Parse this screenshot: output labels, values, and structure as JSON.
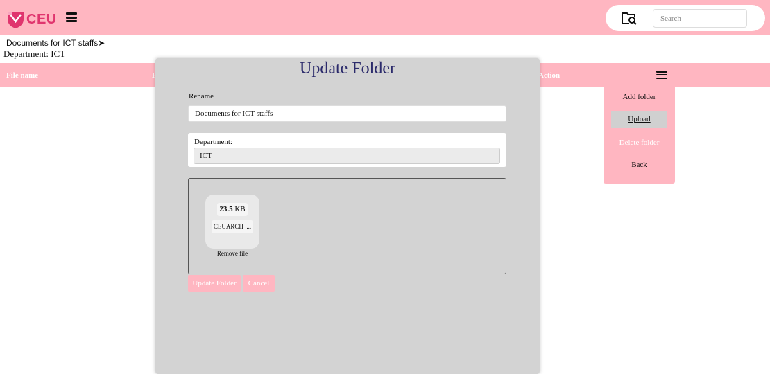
{
  "app": {
    "logo_text": "CEU",
    "brand_color": "#ffb6c1",
    "logo_color": "#e0356e"
  },
  "search": {
    "placeholder": "Search",
    "icon": "folder-search-icon"
  },
  "breadcrumb": {
    "text": "Documents for ICT staffs➤"
  },
  "department_line": "Department: ICT",
  "table": {
    "columns": [
      "File name",
      "F",
      "Action"
    ]
  },
  "menu": {
    "items": [
      "Add folder",
      "Upload",
      "Delete folder",
      "Back"
    ]
  },
  "modal": {
    "title": "Update Folder",
    "rename_label": "Rename",
    "rename_value": "Documents for ICT staffs",
    "department_label": "Department:",
    "department_value": "ICT",
    "file": {
      "size_value": "23.5",
      "size_unit": "KB",
      "name": "CEUARCH_..."
    },
    "remove_file_label": "Remove file",
    "update_button": "Update Folder",
    "cancel_button": "Cancel",
    "title_color": "#2b2a6b"
  }
}
